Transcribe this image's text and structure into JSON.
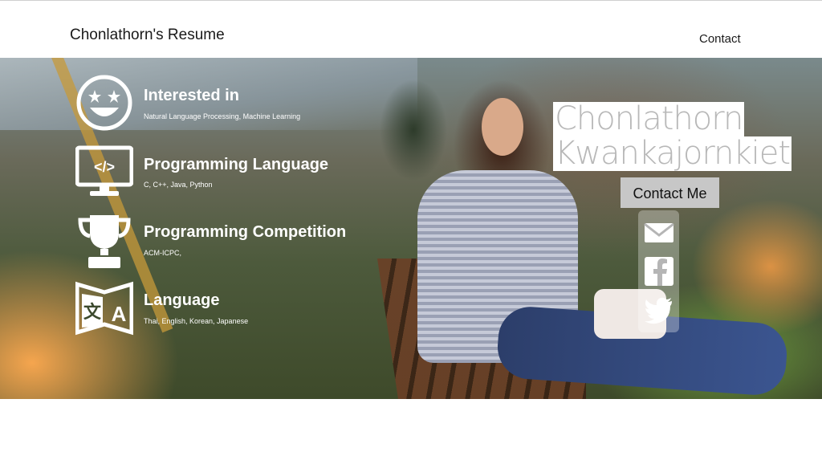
{
  "header": {
    "brand": "Chonlathorn's Resume",
    "nav_contact": "Contact"
  },
  "hero": {
    "items": [
      {
        "icon": "smiley-stars-icon",
        "title": "Interested in",
        "subtitle": "Natural Language Processing, Machine Learning"
      },
      {
        "icon": "code-monitor-icon",
        "title": "Programming Language",
        "subtitle": "C, C++, Java, Python"
      },
      {
        "icon": "trophy-icon",
        "title": "Programming Competition",
        "subtitle": "ACM-ICPC,"
      },
      {
        "icon": "translate-icon",
        "title": "Language",
        "subtitle": "Thai, English, Korean, Japanese"
      }
    ],
    "name_line_1": "Chonlathorn",
    "name_line_2": "Kwankajornkiet",
    "contact_button": "Contact Me",
    "social": [
      "mail-icon",
      "facebook-icon",
      "twitter-icon"
    ]
  }
}
